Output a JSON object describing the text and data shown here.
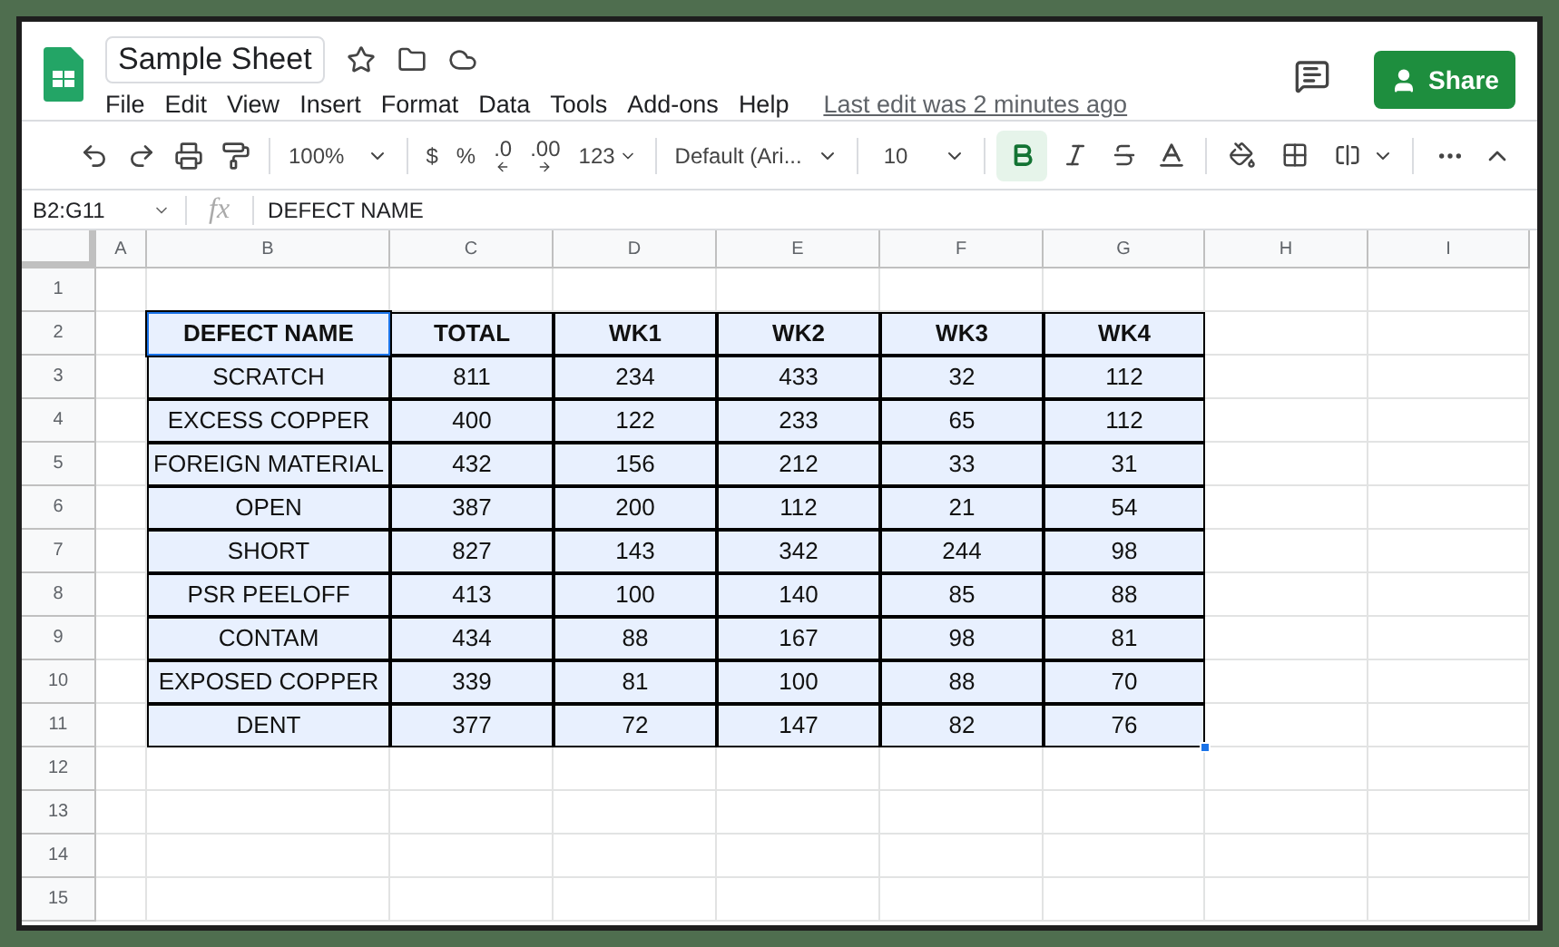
{
  "document": {
    "title": "Sample Sheet",
    "last_edit": "Last edit was 2 minutes ago"
  },
  "menu": [
    "File",
    "Edit",
    "View",
    "Insert",
    "Format",
    "Data",
    "Tools",
    "Add-ons",
    "Help"
  ],
  "share_button": "Share",
  "toolbar": {
    "zoom": "100%",
    "currency": "$",
    "percent": "%",
    "decrease_decimal": ".0",
    "increase_decimal": ".00",
    "more_formats": "123",
    "font": "Default (Ari...",
    "font_size": "10",
    "bold_selected": true
  },
  "formula_bar": {
    "cell_ref": "B2:G11",
    "fx": "fx",
    "value": "DEFECT NAME"
  },
  "columns": [
    "A",
    "B",
    "C",
    "D",
    "E",
    "F",
    "G",
    "H",
    "I"
  ],
  "row_numbers": [
    "1",
    "2",
    "3",
    "4",
    "5",
    "6",
    "7",
    "8",
    "9",
    "10",
    "11",
    "12",
    "13",
    "14",
    "15"
  ],
  "table": {
    "header": [
      "DEFECT NAME",
      "TOTAL",
      "WK1",
      "WK2",
      "WK3",
      "WK4"
    ],
    "rows": [
      [
        "SCRATCH",
        "811",
        "234",
        "433",
        "32",
        "112"
      ],
      [
        "EXCESS COPPER",
        "400",
        "122",
        "233",
        "65",
        "112"
      ],
      [
        "FOREIGN MATERIAL",
        "432",
        "156",
        "212",
        "33",
        "31"
      ],
      [
        "OPEN",
        "387",
        "200",
        "112",
        "21",
        "54"
      ],
      [
        "SHORT",
        "827",
        "143",
        "342",
        "244",
        "98"
      ],
      [
        "PSR PEELOFF",
        "413",
        "100",
        "140",
        "85",
        "88"
      ],
      [
        "CONTAM",
        "434",
        "88",
        "167",
        "98",
        "81"
      ],
      [
        "EXPOSED COPPER",
        "339",
        "81",
        "100",
        "88",
        "70"
      ],
      [
        "DENT",
        "377",
        "72",
        "147",
        "82",
        "76"
      ]
    ]
  }
}
